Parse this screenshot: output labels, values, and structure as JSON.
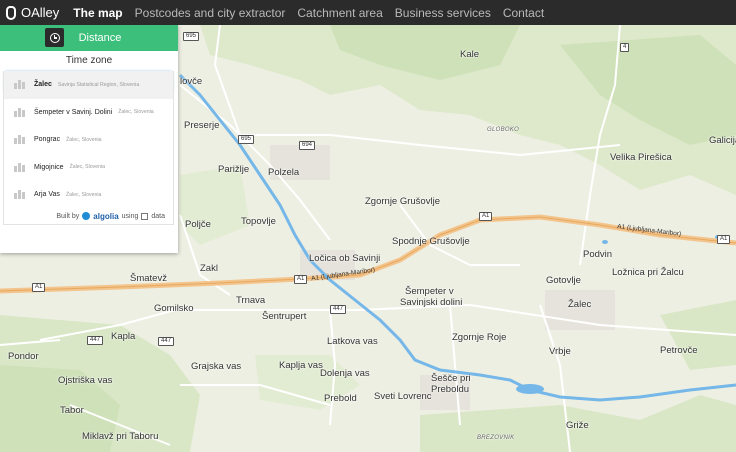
{
  "nav": {
    "brand": "OAlley",
    "links": [
      {
        "label": "The map",
        "active": true
      },
      {
        "label": "Postcodes and city extractor",
        "active": false
      },
      {
        "label": "Catchment area",
        "active": false
      },
      {
        "label": "Business services",
        "active": false
      },
      {
        "label": "Contact",
        "active": false
      }
    ]
  },
  "panel": {
    "distance_label": "Distance",
    "timezone_label": "Time zone",
    "search_value": "Žalec",
    "suggestions": [
      {
        "name": "Žalec",
        "region": "Savinja Statistical Region, Slovenia"
      },
      {
        "name": "Šempeter v Savinj. Dolini",
        "region": "Žalec, Slovenia"
      },
      {
        "name": "Pongrac",
        "region": "Žalec, Slovenia"
      },
      {
        "name": "Migojnice",
        "region": "Žalec, Slovenia"
      },
      {
        "name": "Arja Vas",
        "region": "Žalec, Slovenia"
      }
    ],
    "footer": {
      "built_by": "Built by",
      "algolia": "algolia",
      "using": "using",
      "data": "data"
    }
  },
  "map": {
    "places": {
      "kale": "Kale",
      "globoko": "GLOBOKO",
      "velika_piresica": "Velika Pirešica",
      "galicija": "Galicija",
      "slovce": "lovče",
      "preserje": "Preserje",
      "polzela": "Polzela",
      "parizlje": "Parižlje",
      "zgornje_grusovlje": "Zgornje Grušovlje",
      "spodnje_grusovlje": "Spodnje Grušovlje",
      "podvin": "Podvin",
      "loznica": "Ložnica pri Žalcu",
      "gotovlje": "Gotovlje",
      "polzce": "Poljče",
      "topovlje": "Topovlje",
      "locica": "Ločica ob Savinji",
      "smatevz": "Šmatevž",
      "zakl": "Zakl",
      "trnava": "Trnava",
      "sentrupert": "Šentrupert",
      "gomilsko": "Gomilsko",
      "sempeter1": "Šempeter v",
      "sempeter2": "Savinjski dolini",
      "zalec": "Žalec",
      "kapla": "Kapla",
      "latkova": "Latkova vas",
      "zgornje_roje": "Zgornje Roje",
      "vrbje": "Vrbje",
      "petrovce": "Petrovče",
      "pondor": "Pondor",
      "grajska": "Grajska vas",
      "kaplja": "Kaplja vas",
      "dolenja": "Dolenja vas",
      "sesce": "Šešče pri",
      "sesce2": "Preboldu",
      "ojstriska": "Ojstriška vas",
      "prebold": "Prebold",
      "sveti_lovrenc": "Sveti Lovrenc",
      "tabor": "Tabor",
      "mizklavz": "Miklavž pri Taboru",
      "grize": "Griže",
      "brezovnik": "BREZOVNIK"
    },
    "shields": {
      "s695a": "695",
      "s695b": "695",
      "s694": "694",
      "s4": "4",
      "a1a": "A1",
      "a1b": "A1",
      "a1c": "A1",
      "a1d": "A1",
      "s447a": "447",
      "s447b": "447",
      "s447c": "447"
    },
    "road_labels": {
      "a1_right": "A1 (Ljubljana-Maribor)",
      "a1_center": "A1 (Ljubljana-Maribor)"
    }
  },
  "colors": {
    "nav_bg": "#2b2b2b",
    "distance_green": "#3cbf7a",
    "river": "#74b7e8",
    "motorway": "#f3c48c"
  }
}
